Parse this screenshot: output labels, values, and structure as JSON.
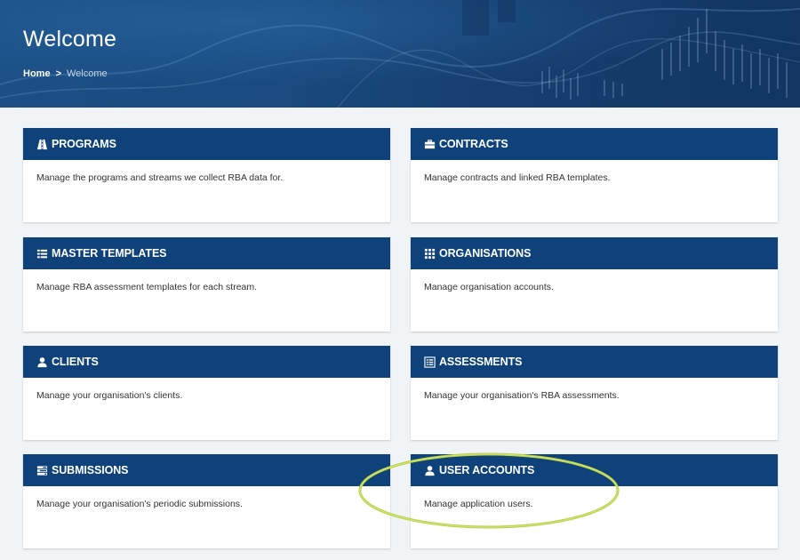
{
  "header": {
    "title": "Welcome",
    "breadcrumb": {
      "home": "Home",
      "separator": ">",
      "current": "Welcome"
    }
  },
  "colors": {
    "card_header": "#0f427b",
    "highlight": "#b7d144"
  },
  "cards": [
    {
      "title": "PROGRAMS",
      "icon": "road-icon",
      "description": "Manage the programs and streams we collect RBA data for."
    },
    {
      "title": "CONTRACTS",
      "icon": "briefcase-icon",
      "description": "Manage contracts and linked RBA templates."
    },
    {
      "title": "MASTER TEMPLATES",
      "icon": "list-icon",
      "description": "Manage RBA assessment templates for each stream."
    },
    {
      "title": "ORGANISATIONS",
      "icon": "grid-icon",
      "description": "Manage organisation accounts."
    },
    {
      "title": "CLIENTS",
      "icon": "user-icon",
      "description": "Manage your organisation's clients."
    },
    {
      "title": "ASSESSMENTS",
      "icon": "list-alt-icon",
      "description": "Manage your organisation's RBA assessments."
    },
    {
      "title": "SUBMISSIONS",
      "icon": "tasks-icon",
      "description": "Manage your organisation's periodic submissions."
    },
    {
      "title": "USER ACCOUNTS",
      "icon": "user-icon",
      "description": "Manage application users."
    }
  ]
}
